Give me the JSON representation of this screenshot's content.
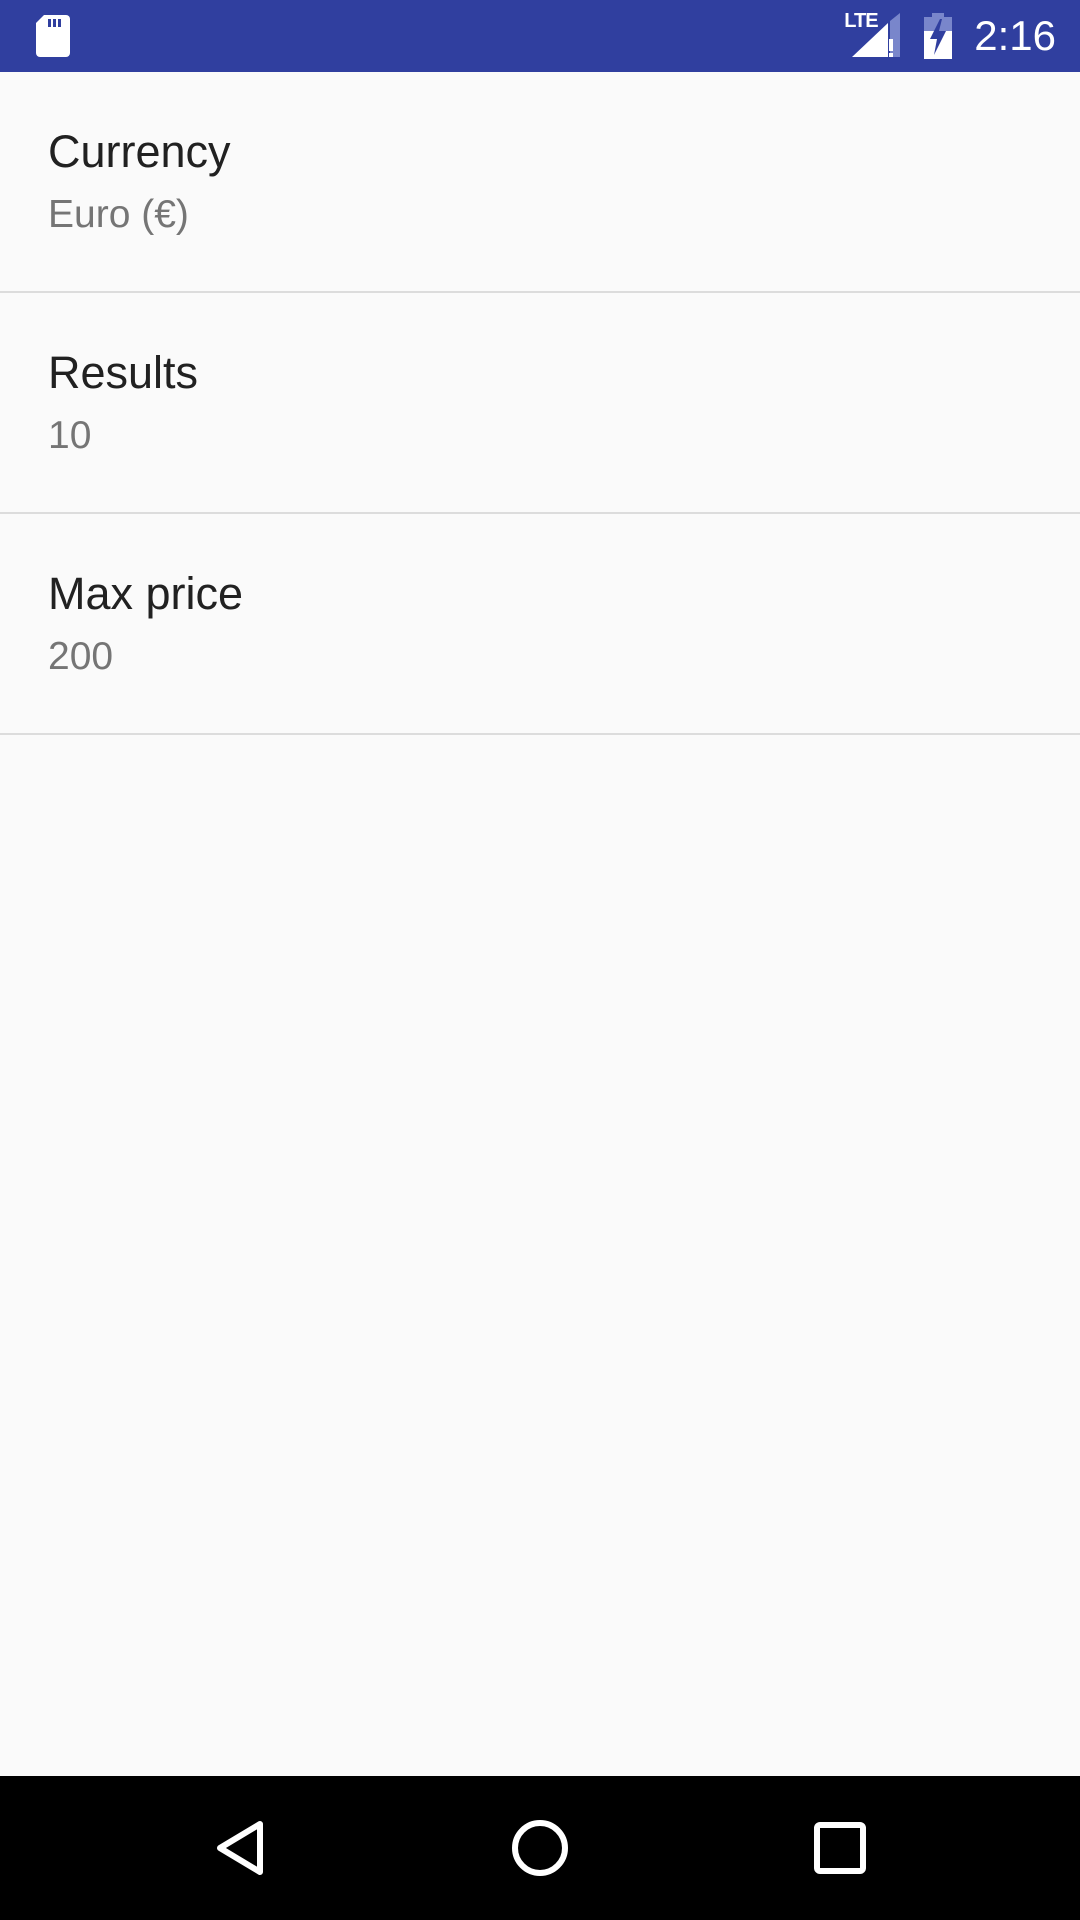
{
  "status_bar": {
    "background_color": "#303f9f",
    "sd_icon": "sd-card-icon",
    "network_label": "LTE",
    "signal_icon": "cell-signal-no-data-icon",
    "battery_icon": "battery-charging-icon",
    "time": "2:16"
  },
  "preferences": [
    {
      "title": "Currency",
      "summary": "Euro (€)"
    },
    {
      "title": "Results",
      "summary": "10"
    },
    {
      "title": "Max price",
      "summary": "200"
    }
  ],
  "nav_bar": {
    "back_icon": "back-triangle-icon",
    "home_icon": "home-circle-icon",
    "recents_icon": "recents-square-icon"
  }
}
